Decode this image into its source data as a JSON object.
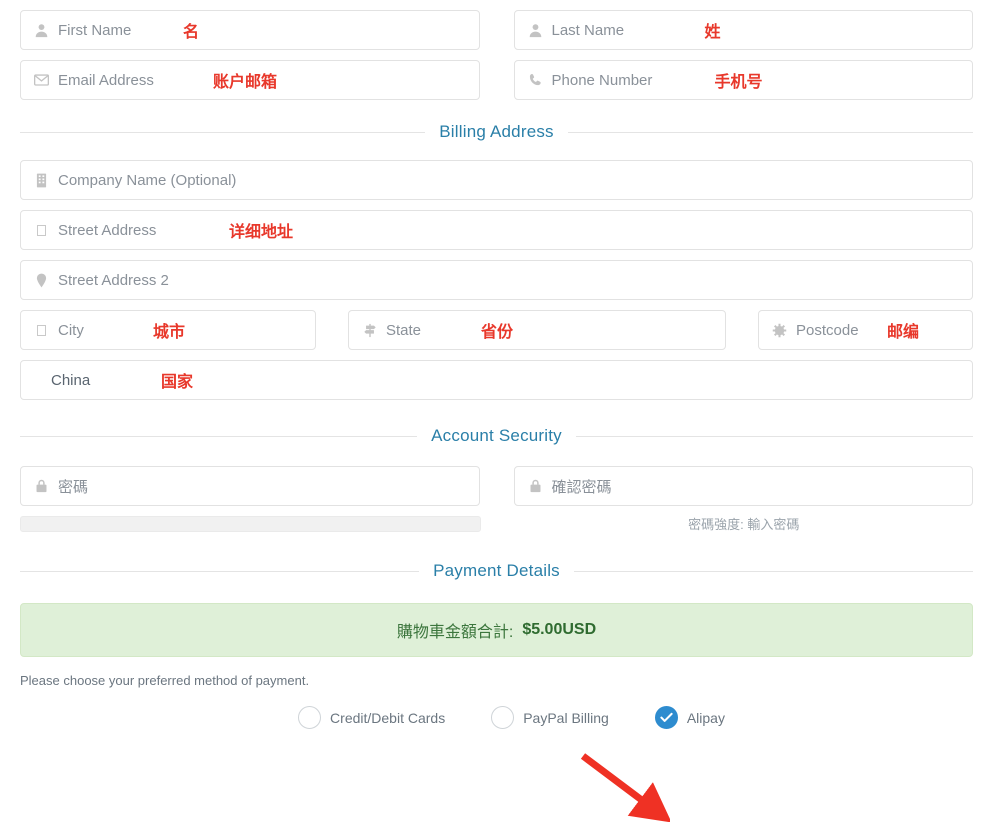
{
  "contact": {
    "first_name": {
      "placeholder": "First Name",
      "annotation": "名",
      "icon": "user-icon"
    },
    "last_name": {
      "placeholder": "Last Name",
      "annotation": "姓",
      "icon": "user-icon"
    },
    "email": {
      "placeholder": "Email Address",
      "annotation": "账户邮箱",
      "icon": "envelope-icon"
    },
    "phone": {
      "placeholder": "Phone Number",
      "annotation": "手机号",
      "icon": "phone-icon"
    }
  },
  "billing": {
    "heading": "Billing Address",
    "company": {
      "placeholder": "Company Name (Optional)",
      "annotation": "",
      "icon": "building-icon"
    },
    "street1": {
      "placeholder": "Street Address",
      "annotation": "详细地址",
      "icon": "missing-glyph-icon"
    },
    "street2": {
      "placeholder": "Street Address 2",
      "annotation": "",
      "icon": "map-pin-icon"
    },
    "city": {
      "placeholder": "City",
      "annotation": "城市",
      "icon": "missing-glyph-icon"
    },
    "state": {
      "placeholder": "State",
      "annotation": "省份",
      "icon": "signpost-icon"
    },
    "postcode": {
      "placeholder": "Postcode",
      "annotation": "邮编",
      "icon": "gear-icon"
    },
    "country": {
      "value": "China",
      "annotation": "国家"
    }
  },
  "security": {
    "heading": "Account Security",
    "password": {
      "placeholder": "密碼",
      "icon": "lock-icon"
    },
    "confirm_password": {
      "placeholder": "確認密碼",
      "icon": "lock-icon"
    },
    "strength_text": "密碼強度: 輸入密碼"
  },
  "payment": {
    "heading": "Payment Details",
    "total_label": "購物車金額合計:",
    "total_amount": "$5.00USD",
    "note": "Please choose your preferred method of payment.",
    "methods": [
      {
        "label": "Credit/Debit Cards",
        "selected": false
      },
      {
        "label": "PayPal Billing",
        "selected": false
      },
      {
        "label": "Alipay",
        "selected": true
      }
    ]
  },
  "colors": {
    "heading": "#2a7fa8",
    "annotation": "#e8382b",
    "total_bg": "#dff0d8",
    "total_text": "#3c763d",
    "radio_selected": "#2e8ccf",
    "arrow": "#ef3124"
  }
}
